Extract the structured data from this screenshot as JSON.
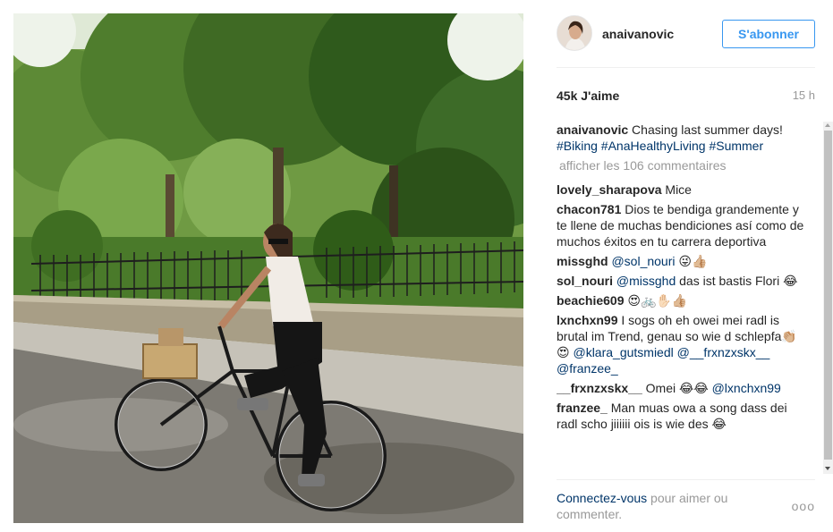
{
  "post": {
    "image_alt": "woman on bicycle with wicker basket in a sunny tree-lined street"
  },
  "header": {
    "username": "anaivanovic",
    "follow_label": "S'abonner"
  },
  "stats": {
    "likes": "45k J'aime",
    "time": "15 h"
  },
  "caption": {
    "author": "anaivanovic",
    "text": "Chasing last summer days!",
    "hashtags": "#Biking #AnaHealthyLiving #Summer"
  },
  "load_more": "afficher les 106 commentaires",
  "comments": [
    {
      "author": "lovely_sharapova",
      "text": "Mice"
    },
    {
      "author": "chacon781",
      "text": "Dios te bendiga grandemente y te llene de muchas bendiciones así como de muchos éxitos en tu carrera deportiva"
    },
    {
      "author": "missghd",
      "text": "@sol_nouri 😜👍🏼"
    },
    {
      "author": "sol_nouri",
      "text": "@missghd das ist bastis Flori 😂"
    },
    {
      "author": "beachie609",
      "text": "😍🚲✋🏻👍🏼"
    },
    {
      "author": "lxnchxn99",
      "text": "I sogs oh eh owei mei radl is brutal im Trend, genau so wie d schlepfa👏🏼😍 @klara_gutsmiedl @__frxnzxskx__ @franzee_"
    },
    {
      "author": "__frxnzxskx__",
      "text": "Omei 😂😂 @lxnchxn99"
    },
    {
      "author": "franzee_",
      "text": "Man muas owa a song dass dei radl scho jiiiiii ois is wie des 😂"
    }
  ],
  "footer": {
    "login_link": "Connectez-vous",
    "login_rest": " pour aimer ou commenter.",
    "more": "ooo"
  },
  "colors": {
    "link_blue": "#3897f0",
    "hashtag_navy": "#003569",
    "muted_gray": "#999999",
    "text_dark": "#262626"
  }
}
